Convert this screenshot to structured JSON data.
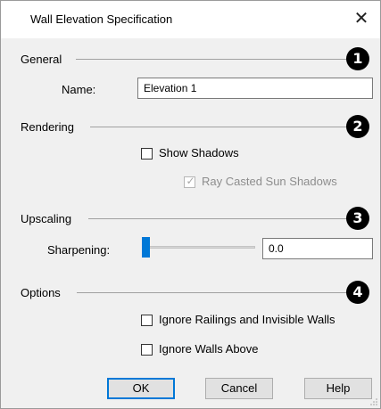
{
  "dialog": {
    "title": "Wall Elevation Specification",
    "close_glyph": "✕"
  },
  "groups": {
    "general": {
      "label": "General",
      "marker": "1",
      "name_label": "Name:",
      "name_value": "Elevation 1"
    },
    "rendering": {
      "label": "Rendering",
      "marker": "2",
      "show_shadows": {
        "label": "Show Shadows",
        "checked": false,
        "enabled": true
      },
      "ray_casted": {
        "label": "Ray Casted Sun Shadows",
        "checked": true,
        "enabled": false
      }
    },
    "upscaling": {
      "label": "Upscaling",
      "marker": "3",
      "sharpening_label": "Sharpening:",
      "sharpening_value": "0.0",
      "slider_level": 0.0
    },
    "options": {
      "label": "Options",
      "marker": "4",
      "ignore_railings": {
        "label": "Ignore Railings and Invisible Walls",
        "checked": false
      },
      "ignore_walls_above": {
        "label": "Ignore Walls Above",
        "checked": false
      }
    }
  },
  "buttons": {
    "ok": "OK",
    "cancel": "Cancel",
    "help": "Help"
  },
  "colors": {
    "accent": "#0078d7",
    "marker": "#000000",
    "dialog_bg": "#f0f0f0"
  }
}
